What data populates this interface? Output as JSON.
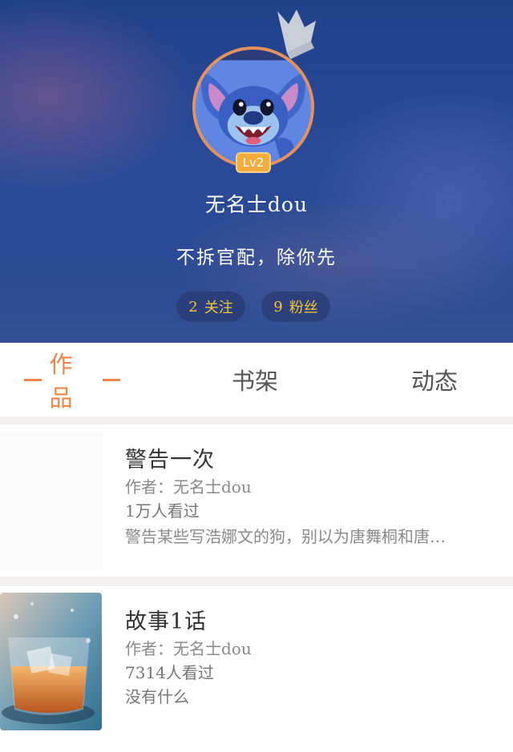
{
  "profile": {
    "level": "Lv2",
    "username": "无名士dou",
    "signature": "不拆官配，除你先",
    "following": {
      "count": "2",
      "label": "关注"
    },
    "fans": {
      "count": "9",
      "label": "粉丝"
    }
  },
  "tabs": [
    {
      "label": "作品",
      "active": true
    },
    {
      "label": "书架",
      "active": false
    },
    {
      "label": "动态",
      "active": false
    }
  ],
  "works": [
    {
      "title": "警告一次",
      "author": "作者：无名士dou",
      "views": "1万人看过",
      "description": "警告某些写浩娜文的狗，别以为唐舞桐和唐…"
    },
    {
      "title": "故事1话",
      "author": "作者：无名士dou",
      "views": "7314人看过",
      "description": "没有什么"
    }
  ],
  "colors": {
    "accent": "#ef8448",
    "stat_text": "#f2c736",
    "header_bg": "#2a4a98",
    "level_badge": "#f1ac3b"
  },
  "icons": [
    "crown-icon",
    "avatar-image",
    "cover-image"
  ]
}
